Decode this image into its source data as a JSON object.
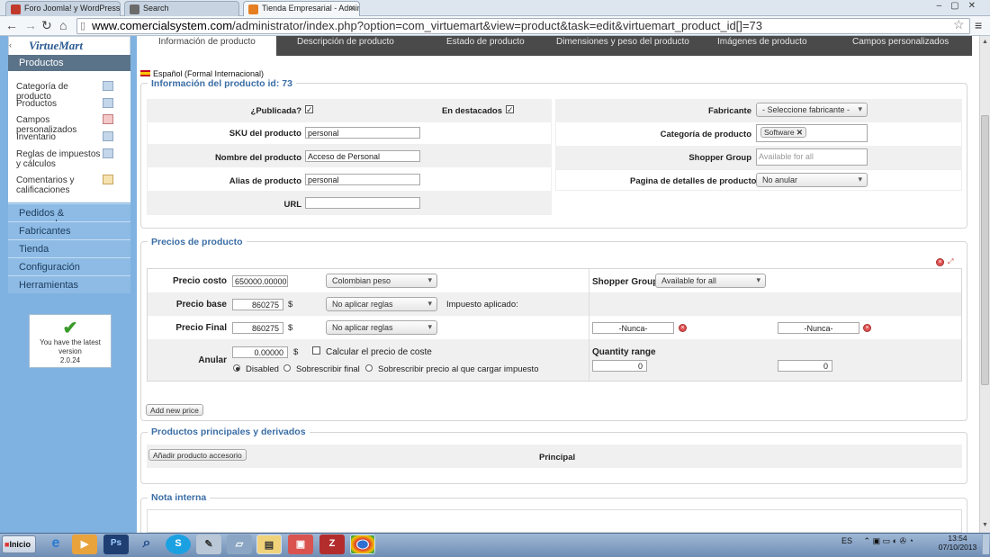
{
  "browser": {
    "tabs": [
      {
        "title": "Foro Joomla! y WordPress d",
        "icon_color": "#c0392b"
      },
      {
        "title": "Search",
        "icon_color": "#6b6b6b"
      },
      {
        "title": "Tienda Empresarial - Admin",
        "icon_color": "#e67e22"
      }
    ],
    "url_host": "www.comercialsystem.com",
    "url_path": "/administrator/index.php?option=com_virtuemart&view=product&task=edit&virtuemart_product_id[]=73"
  },
  "sidebar": {
    "logo": "VirtueMart",
    "section": "Productos",
    "submenu": [
      "Categoría de producto",
      "Productos",
      "Campos personalizados",
      "Inventario",
      "Reglas de impuestos y cálculos",
      "Comentarios y calificaciones"
    ],
    "menu": [
      "Pedidos & compradores",
      "Fabricantes",
      "Tienda",
      "Configuración",
      "Herramientas"
    ],
    "version_text": "You have the latest version",
    "version_number": "2.0.24"
  },
  "tabs": [
    "Información de producto",
    "Descripción de producto",
    "Estado de producto",
    "Dimensiones y peso del producto",
    "Imágenes de producto",
    "Campos personalizados"
  ],
  "language": "Español (Formal Internacional)",
  "info": {
    "legend": "Información del producto id: 73",
    "published_label": "¿Publicada?",
    "featured_label": "En destacados",
    "sku_label": "SKU del producto",
    "sku_value": "personal",
    "name_label": "Nombre del producto",
    "name_value": "Acceso de Personal",
    "alias_label": "Alias de producto",
    "alias_value": "personal",
    "url_label": "URL",
    "url_value": "",
    "manufacturer_label": "Fabricante",
    "manufacturer_value": "- Seleccione fabricante -",
    "category_label": "Categoría de producto",
    "category_tag": "Software",
    "shopper_group_label": "Shopper Group",
    "shopper_group_placeholder": "Available for all",
    "detail_page_label": "Pagina de detalles de producto",
    "detail_page_value": "No anular"
  },
  "prices": {
    "legend": "Precios de producto",
    "cost_label": "Precio costo",
    "cost_value": "650000.00000",
    "currency_value": "Colombian peso",
    "shopper_group_label": "Shopper Group",
    "shopper_group_value": "Available for all",
    "base_label": "Precio base",
    "base_value": "860275",
    "currency_symbol": "$",
    "base_rule": "No aplicar reglas",
    "tax_applied_label": "Impuesto aplicado:",
    "final_label": "Precio Final",
    "final_value": "860275",
    "final_rule": "No aplicar reglas",
    "date_from": "-Nunca-",
    "date_to": "-Nunca-",
    "override_label": "Anular",
    "override_value": "0.00000",
    "calc_cost_label": "Calcular el precio de coste",
    "radio_disabled": "Disabled",
    "radio_final": "Sobrescribir final",
    "radio_tax": "Sobrescribir precio al que cargar impuesto",
    "quantity_label": "Quantity range",
    "qty_from": "0",
    "qty_to": "0",
    "add_price_button": "Add new price"
  },
  "related": {
    "legend": "Productos principales y derivados",
    "add_accessory_button": "Añadir producto accesorio",
    "main_label": "Principal"
  },
  "note": {
    "legend": "Nota interna"
  },
  "taskbar": {
    "start_label": "Inicio",
    "lang": "ES",
    "time": "13:54",
    "date": "07/10/2013"
  }
}
